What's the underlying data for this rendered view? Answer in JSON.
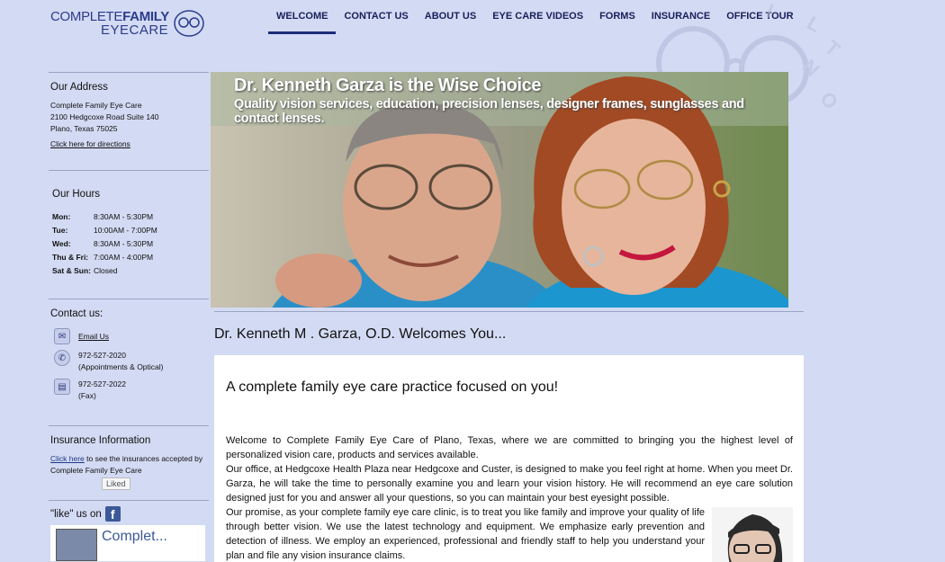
{
  "logo": {
    "line1_a": "COMPLETE",
    "line1_b": "FAMILY",
    "line2": "EYECARE"
  },
  "nav": [
    "WELCOME",
    "CONTACT US",
    "ABOUT US",
    "EYE CARE VIDEOS",
    "FORMS",
    "INSURANCE",
    "OFFICE TOUR"
  ],
  "sidebar": {
    "address": {
      "title": "Our Address",
      "name": "Complete Family Eye Care",
      "street": "2100 Hedgcoxe Road Suite 140",
      "city": "Plano, Texas 75025",
      "directions_link": "Click here for directions"
    },
    "hours": {
      "title": "Our Hours",
      "rows": [
        {
          "day": "Mon:",
          "time": "8:30AM - 5:30PM"
        },
        {
          "day": "Tue:",
          "time": "10:00AM - 7:00PM"
        },
        {
          "day": "Wed:",
          "time": "8:30AM - 5:30PM"
        },
        {
          "day": "Thu & Fri:",
          "time": "7:00AM - 4:00PM"
        },
        {
          "day": "Sat & Sun:",
          "time": "Closed"
        }
      ]
    },
    "contact": {
      "title": "Contact us:",
      "email_link": "Email Us",
      "phone": "972-527-2020",
      "phone_note": "(Appointments & Optical)",
      "fax": "972-527-2022",
      "fax_note": "(Fax)"
    },
    "insurance": {
      "title": "Insurance Information",
      "link": "Click here",
      "text": " to see the insurances accepted by Complete Family Eye Care"
    },
    "facebook": {
      "label": "\"like\" us on",
      "page_name": "Complet...",
      "like_button": "Liked"
    }
  },
  "banner": {
    "title": "Dr. Kenneth Garza is the Wise Choice",
    "subtitle": "Quality vision services, education, precision lenses, designer frames, sunglasses and contact lenses."
  },
  "main": {
    "heading": "Dr. Kenneth M . Garza, O.D. Welcomes You...",
    "content_heading": "A complete family eye care practice focused on you!",
    "paragraphs": [
      "Welcome to Complete Family Eye Care of Plano, Texas, where we are committed to bringing you the highest level of personalized vision care, products and services available.",
      "Our office, at Hedgcoxe Health Plaza near Hedgcoxe and Custer, is designed to make you feel right at home. When you meet Dr. Garza, he will take the time to personally examine you and learn your vision history. He will recommend an eye care solution designed just for you and answer all your questions, so you can maintain your best eyesight possible.",
      "Our promise, as your complete family eye care clinic, is to treat you like family and improve your quality of life through better vision. We use the latest technology and equipment. We emphasize early prevention and detection of illness. We employ an experienced, professional and friendly staff to help you understand your plan and file any vision insurance claims."
    ]
  }
}
